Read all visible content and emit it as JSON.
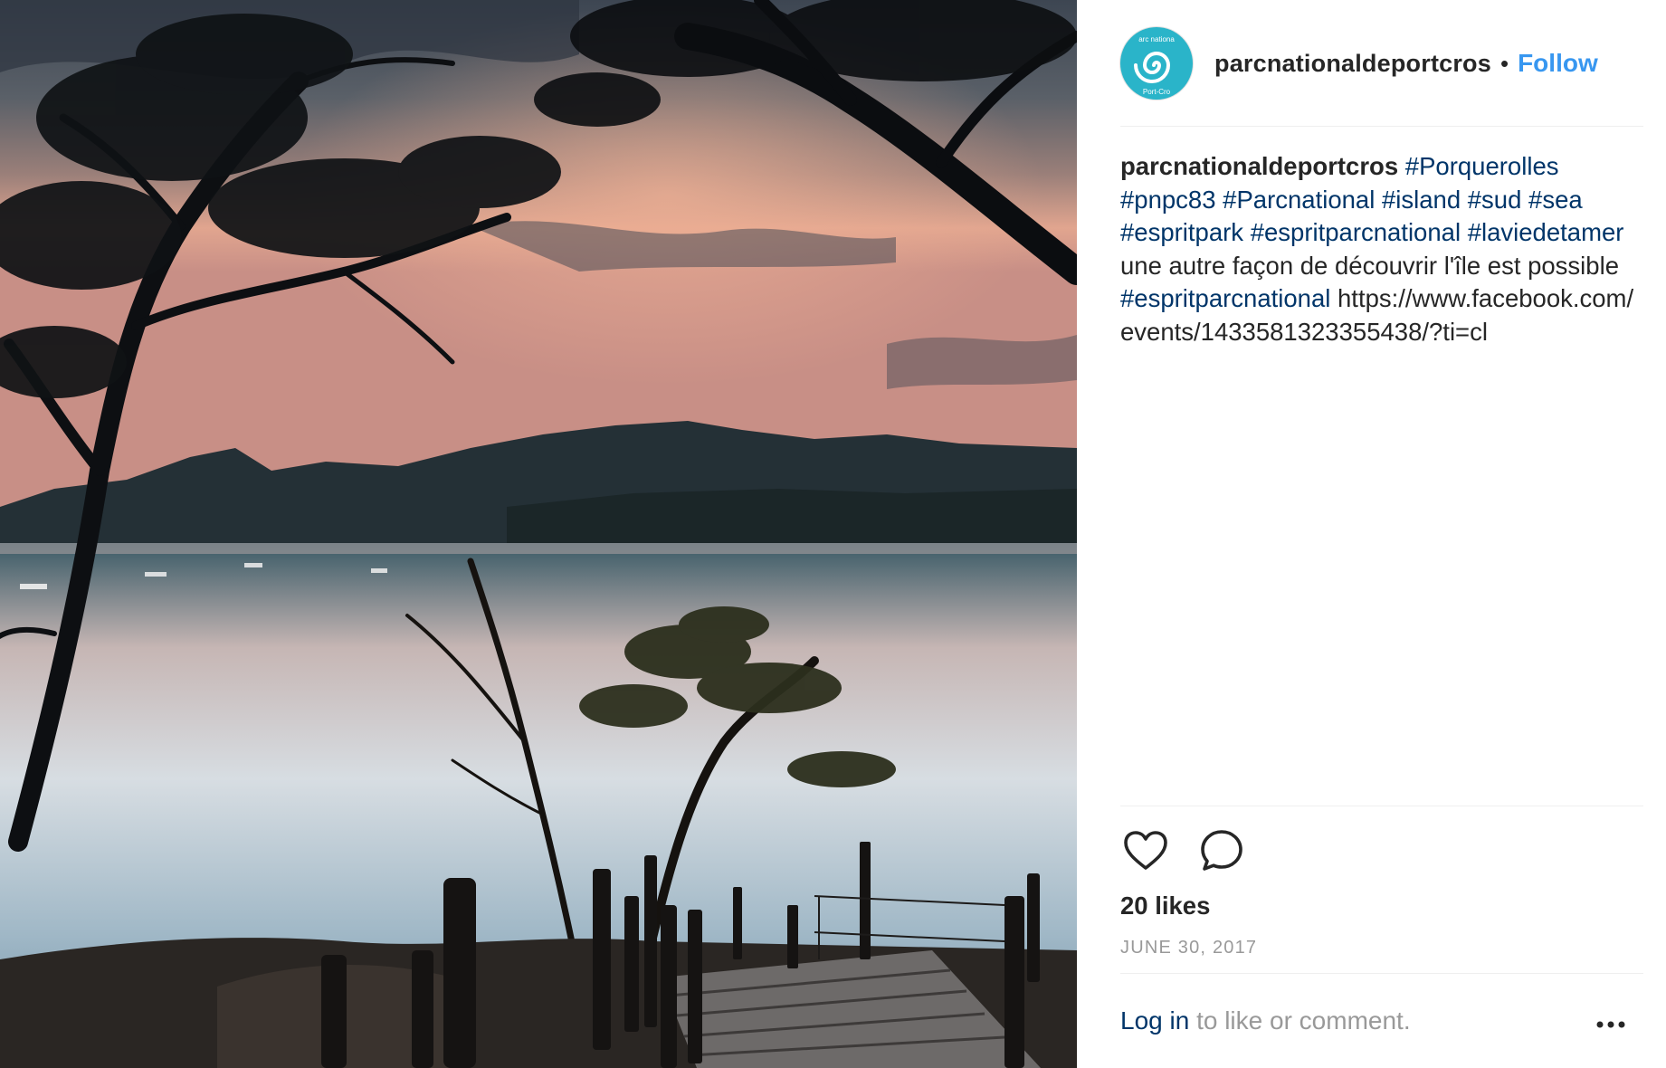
{
  "post": {
    "username": "parcnationaldeportcros",
    "separator": "•",
    "follow_label": "Follow",
    "avatar_icon": "spiral-logo-icon",
    "avatar_text_top": "arc nationa",
    "avatar_text_bottom": "Port-Cro",
    "caption": {
      "username": "parcnationaldeportcros",
      "tags_line1": [
        "#Porquerolles"
      ],
      "tags_line2": [
        "#pnpc83",
        "#Parcnational",
        "#island",
        "#sud",
        "#sea"
      ],
      "tags_line3": [
        "#espritpark",
        "#espritparcnational"
      ],
      "tag_laviedetamer": "#laviedetamer",
      "text_1": "une autre façon de découvrir l'île est possible",
      "tag_end": "#espritparcnational",
      "url": "https://www.facebook.com/events/1433581323355438/?ti=cl"
    },
    "likes": "20 likes",
    "date": "JUNE 30, 2017",
    "footer": {
      "login_label": "Log in",
      "rest": "to like or comment."
    },
    "icons": {
      "like": "heart-icon",
      "comment": "comment-bubble-icon",
      "more": "more-options-icon"
    },
    "colors": {
      "link": "#003569",
      "follow": "#3897f0",
      "muted": "#999999",
      "avatar_bg": "#2ab4c9"
    }
  }
}
